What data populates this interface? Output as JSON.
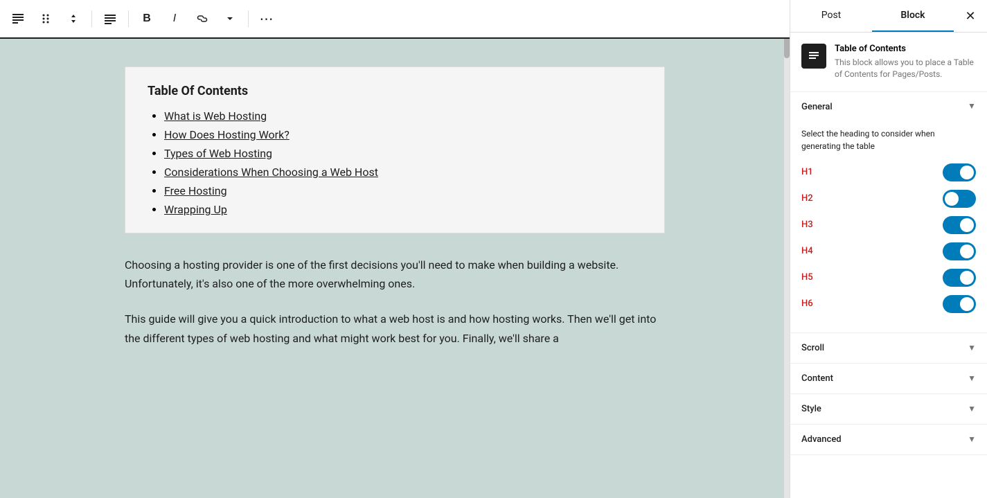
{
  "toolbar": {
    "block_icon_label": "≡",
    "drag_icon_label": "⠿",
    "move_icon_label": "↕",
    "align_icon_label": "▤",
    "bold_label": "B",
    "italic_label": "I",
    "link_label": "🔗",
    "dropdown_label": "▾",
    "more_label": "⋯"
  },
  "toc": {
    "title": "Table Of Contents",
    "items": [
      {
        "text": "What is Web Hosting",
        "href": "#"
      },
      {
        "text": "How Does Hosting Work?",
        "href": "#"
      },
      {
        "text": "Types of Web Hosting",
        "href": "#"
      },
      {
        "text": "Considerations When Choosing a Web Host",
        "href": "#"
      },
      {
        "text": "Free Hosting",
        "href": "#"
      },
      {
        "text": "Wrapping Up",
        "href": "#"
      }
    ]
  },
  "body_paragraphs": [
    "Choosing a hosting provider is one of the first decisions you'll need to make when building a website. Unfortunately, it's also one of the more overwhelming ones.",
    "This guide will give you a quick introduction to what a web host is and how hosting works. Then we'll get into the different types of web hosting and what might work best for you. Finally, we'll share a"
  ],
  "panel": {
    "tabs": [
      {
        "label": "Post",
        "active": false
      },
      {
        "label": "Block",
        "active": true
      }
    ],
    "close_label": "✕",
    "block_icon_symbol": "☰",
    "block_name": "Table of Contents",
    "block_desc": "This block allows you to place a Table of Contents for Pages/Posts.",
    "sections": {
      "general": {
        "label": "General",
        "expanded": true,
        "description": "Select the heading to consider when generating the table",
        "toggles": [
          {
            "id": "H1",
            "state": "on"
          },
          {
            "id": "H2",
            "state": "mid"
          },
          {
            "id": "H3",
            "state": "on"
          },
          {
            "id": "H4",
            "state": "on"
          },
          {
            "id": "H5",
            "state": "on"
          },
          {
            "id": "H6",
            "state": "on"
          }
        ]
      },
      "scroll": {
        "label": "Scroll",
        "expanded": false
      },
      "content": {
        "label": "Content",
        "expanded": false
      },
      "style": {
        "label": "Style",
        "expanded": false
      },
      "advanced": {
        "label": "Advanced",
        "expanded": false
      }
    }
  }
}
